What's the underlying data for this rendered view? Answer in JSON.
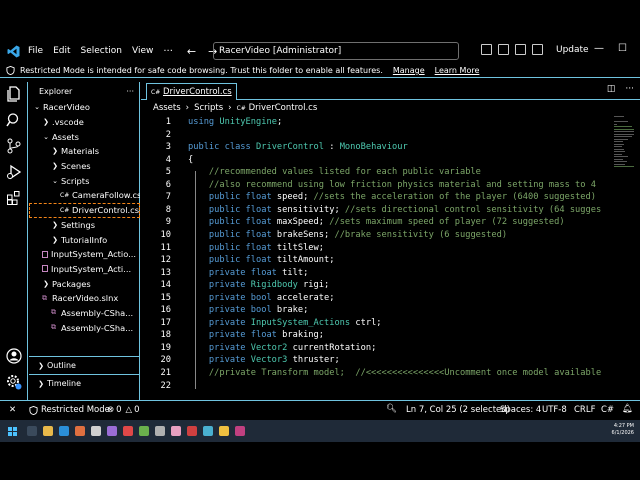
{
  "titlebar": {
    "menu": [
      "File",
      "Edit",
      "Selection",
      "View"
    ],
    "search_text": "RacerVideo [Administrator]",
    "update_label": "Update"
  },
  "banner": {
    "message": "Restricted Mode is intended for safe code browsing. Trust this folder to enable all features.",
    "manage": "Manage",
    "learn_more": "Learn More"
  },
  "sidebar": {
    "title": "Explorer",
    "tree": [
      {
        "label": "RacerVideo",
        "kind": "folder-open",
        "depth": 0
      },
      {
        "label": ".vscode",
        "kind": "folder",
        "depth": 1
      },
      {
        "label": "Assets",
        "kind": "folder-open",
        "depth": 1
      },
      {
        "label": "Materials",
        "kind": "folder",
        "depth": 2
      },
      {
        "label": "Scenes",
        "kind": "folder",
        "depth": 2
      },
      {
        "label": "Scripts",
        "kind": "folder-open",
        "depth": 2
      },
      {
        "label": "CameraFollow.cs",
        "kind": "cs",
        "depth": 3
      },
      {
        "label": "DriverControl.cs",
        "kind": "cs",
        "depth": 3,
        "selected": true
      },
      {
        "label": "Settings",
        "kind": "folder",
        "depth": 2
      },
      {
        "label": "TutorialInfo",
        "kind": "folder",
        "depth": 2
      },
      {
        "label": "InputSystem_Actio...",
        "kind": "file",
        "depth": 1
      },
      {
        "label": "InputSystem_Acti...",
        "kind": "file",
        "depth": 1
      },
      {
        "label": "Packages",
        "kind": "folder",
        "depth": 1
      },
      {
        "label": "RacerVideo.slnx",
        "kind": "sln",
        "depth": 1
      },
      {
        "label": "Assembly-CSha...",
        "kind": "sln",
        "depth": 2
      },
      {
        "label": "Assembly-CSha...",
        "kind": "sln",
        "depth": 2
      }
    ],
    "outline": "Outline",
    "timeline": "Timeline"
  },
  "editor": {
    "tab_label": "DriverControl.cs",
    "breadcrumb": [
      "Assets",
      "Scripts",
      "DriverControl.cs"
    ],
    "lines": [
      {
        "n": "1",
        "segs": [
          [
            "kw",
            "using "
          ],
          [
            "ty",
            "UnityEngine"
          ],
          [
            "",
            "; "
          ]
        ]
      },
      {
        "n": "2",
        "segs": []
      },
      {
        "n": "3",
        "segs": [
          [
            "kw",
            "public class "
          ],
          [
            "ty",
            "DriverControl"
          ],
          [
            "",
            " : "
          ],
          [
            "ty",
            "MonoBehaviour"
          ]
        ]
      },
      {
        "n": "4",
        "segs": [
          [
            "",
            "{"
          ]
        ]
      },
      {
        "n": "5",
        "segs": [
          [
            "cm",
            "    //recommended values listed for each public variable"
          ]
        ]
      },
      {
        "n": "6",
        "segs": [
          [
            "cm",
            "    //also recommend using low friction physics material and setting mass to 4"
          ]
        ]
      },
      {
        "n": "7",
        "segs": [
          [
            "kw",
            "    public float "
          ],
          [
            "",
            "speed; "
          ],
          [
            "cm",
            "//sets the acceleration of the player (6400 suggested)"
          ]
        ]
      },
      {
        "n": "8",
        "segs": [
          [
            "kw",
            "    public float "
          ],
          [
            "",
            "sensitivity; "
          ],
          [
            "cm",
            "//sets directional control sensitivity (64 sugges"
          ]
        ]
      },
      {
        "n": "9",
        "segs": [
          [
            "kw",
            "    public float "
          ],
          [
            "",
            "maxSpeed; "
          ],
          [
            "cm",
            "//sets maximum speed of player (72 suggested)"
          ]
        ]
      },
      {
        "n": "10",
        "segs": [
          [
            "kw",
            "    public float "
          ],
          [
            "",
            "brakeSens; "
          ],
          [
            "cm",
            "//brake sensitivity (6 suggested)"
          ]
        ]
      },
      {
        "n": "11",
        "segs": [
          [
            "kw",
            "    public float "
          ],
          [
            "",
            "tiltSlew;"
          ]
        ]
      },
      {
        "n": "12",
        "segs": [
          [
            "kw",
            "    public float "
          ],
          [
            "",
            "tiltAmount;"
          ]
        ]
      },
      {
        "n": "13",
        "segs": [
          [
            "kw",
            "    private float "
          ],
          [
            "",
            "tilt;"
          ]
        ]
      },
      {
        "n": "14",
        "segs": [
          [
            "kw",
            "    private "
          ],
          [
            "ty",
            "Rigidbody "
          ],
          [
            "",
            "rigi;"
          ]
        ]
      },
      {
        "n": "15",
        "segs": [
          [
            "kw",
            "    private bool "
          ],
          [
            "",
            "accelerate;"
          ]
        ]
      },
      {
        "n": "16",
        "segs": [
          [
            "kw",
            "    private bool "
          ],
          [
            "",
            "brake;"
          ]
        ]
      },
      {
        "n": "17",
        "segs": [
          [
            "kw",
            "    private "
          ],
          [
            "ty",
            "InputSystem_Actions "
          ],
          [
            "",
            "ctrl;"
          ]
        ]
      },
      {
        "n": "18",
        "segs": [
          [
            "kw",
            "    private float "
          ],
          [
            "",
            "braking;"
          ]
        ]
      },
      {
        "n": "19",
        "segs": [
          [
            "kw",
            "    private "
          ],
          [
            "ty",
            "Vector2 "
          ],
          [
            "",
            "currentRotation;"
          ]
        ]
      },
      {
        "n": "20",
        "segs": [
          [
            "kw",
            "    private "
          ],
          [
            "ty",
            "Vector3 "
          ],
          [
            "",
            "thruster;"
          ]
        ]
      },
      {
        "n": "21",
        "segs": [
          [
            "cm",
            "    //private Transform model;  //<<<<<<<<<<<<<<<Uncomment once model available"
          ]
        ]
      },
      {
        "n": "22",
        "segs": []
      }
    ]
  },
  "statusbar": {
    "restricted": "Restricted Mode",
    "errors": "0",
    "warnings": "0",
    "position": "Ln 7, Col 25 (2 selected)",
    "spaces": "Spaces: 4",
    "encoding": "UTF-8",
    "eol": "CRLF",
    "language": "C#"
  },
  "taskbar": {
    "time": "4:27 PM",
    "date": "6/1/2026"
  }
}
